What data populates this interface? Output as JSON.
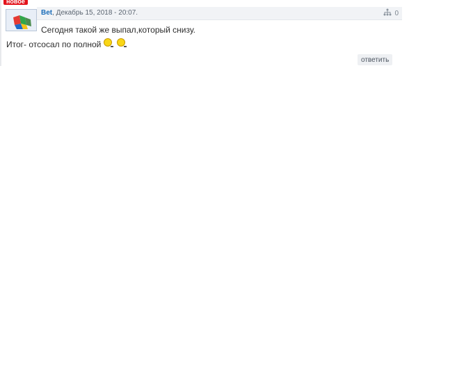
{
  "comment": {
    "badge": "новое",
    "author": "Bet",
    "date": ", Декабрь 15, 2018 - 20:07.",
    "reputation_count": "0",
    "text_line1": "Сегодня такой же выпал,который снизу.",
    "text_line2": "Итог- отсосал по полной",
    "reply_label": "ответить",
    "icons": {
      "avatar": "avatar-flag-icon",
      "reputation": "network-icon",
      "emoji_1": "smile-emoji-icon",
      "emoji_2": "smile-emoji-icon"
    }
  },
  "colors": {
    "badge": "#e3121b",
    "author_link": "#1a6cb8",
    "header_bg": "#f1f3f6"
  }
}
